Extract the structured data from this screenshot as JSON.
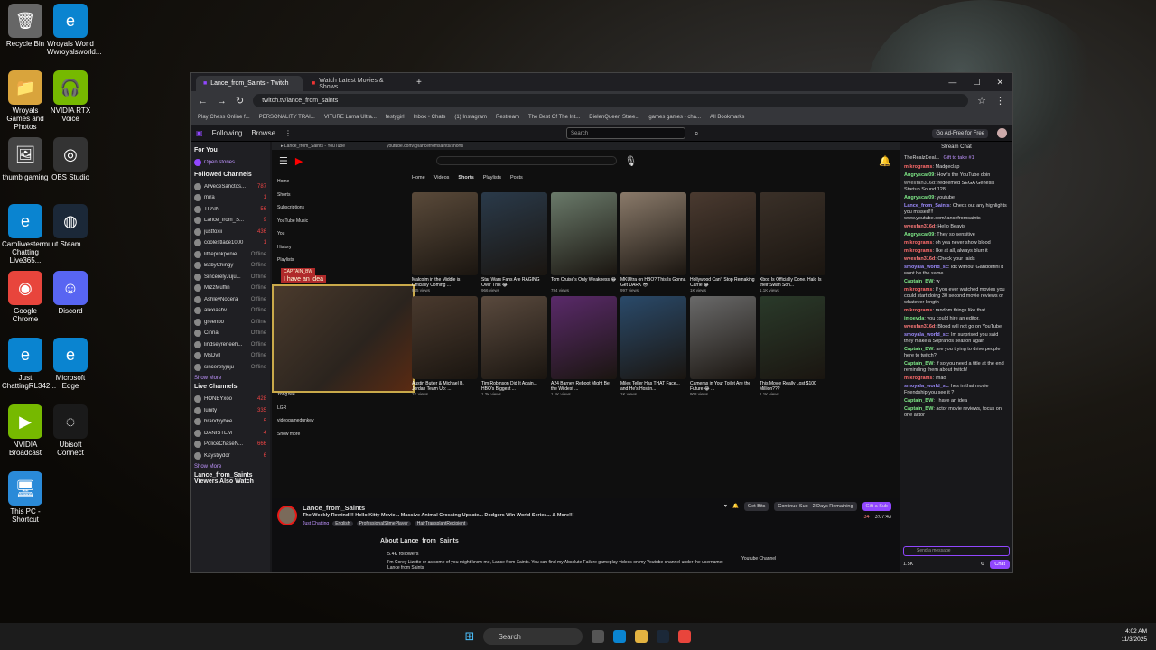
{
  "desktop": {
    "icons": [
      {
        "label": "Recycle Bin",
        "glyph": "🗑",
        "color": "#666"
      },
      {
        "label": "Wroyals Games and Photos",
        "glyph": "📁",
        "color": "#d9a43c"
      },
      {
        "label": "thumb gaming",
        "glyph": "🖼",
        "color": "#444"
      },
      {
        "label": "Caroliwestermuut Chatting Live365...",
        "glyph": "e",
        "color": "#0a84d0"
      },
      {
        "label": "Google Chrome",
        "glyph": "◉",
        "color": "#e8453c"
      },
      {
        "label": "Just ChattingRL342...",
        "glyph": "e",
        "color": "#0a84d0"
      },
      {
        "label": "NVIDIA Broadcast",
        "glyph": "▶",
        "color": "#76b900"
      },
      {
        "label": "This PC - Shortcut",
        "glyph": "🖥",
        "color": "#2a8ad8"
      },
      {
        "label": "Wroyals World Wwroyalsworld...",
        "glyph": "e",
        "color": "#0a84d0"
      },
      {
        "label": "NVIDIA RTX Voice",
        "glyph": "🎧",
        "color": "#76b900"
      },
      {
        "label": "OBS Studio",
        "glyph": "◎",
        "color": "#333"
      },
      {
        "label": "Steam",
        "glyph": "◍",
        "color": "#1b2838"
      },
      {
        "label": "Discord",
        "glyph": "☺",
        "color": "#5865f2"
      },
      {
        "label": "Microsoft Edge",
        "glyph": "e",
        "color": "#0a84d0"
      },
      {
        "label": "Ubisoft Connect",
        "glyph": "◌",
        "color": "#1a1a1a"
      }
    ]
  },
  "browser": {
    "tabs": [
      {
        "label": "Lance_from_Saints - Twitch"
      },
      {
        "label": "Watch Latest Movies & Shows"
      }
    ],
    "url": "twitch.tv/lance_from_saints",
    "bookmarks": [
      "Play Chess Online f...",
      "PERSONALITY TRAI...",
      "VITURE Luma Ultra...",
      "festygirl",
      "Inbox • Chats",
      "(1) Instagram",
      "Restream",
      "The Best Of The Int...",
      "DielenQueen Stree...",
      "games games - cha...",
      "All Bookmarks"
    ]
  },
  "twitch": {
    "nav": {
      "following": "Following",
      "browse": "Browse",
      "search_placeholder": "Search",
      "ad_free": "Go Ad-Free for Free"
    },
    "sidebar": {
      "for_you": "For You",
      "open_stories": "Open stories",
      "followed_header": "Followed Channels",
      "channels": [
        {
          "name": "AlweceSanctos...",
          "sub": "Animals, Aqua...",
          "count": "787"
        },
        {
          "name": "mira",
          "sub": "Just Chatting",
          "count": "1"
        },
        {
          "name": "TPAIN",
          "sub": "IRL There Yet?",
          "count": "56"
        },
        {
          "name": "Lance_from_S...",
          "sub": "Just Chatting",
          "count": "9"
        },
        {
          "name": "justfoxii",
          "sub": "Counter-Strike",
          "count": "436"
        },
        {
          "name": "coolestlace1000",
          "sub": "Warframe",
          "count": "1"
        },
        {
          "name": "littlepinkpenie",
          "sub": "",
          "count": "Offline"
        },
        {
          "name": "BabyChingy",
          "sub": "",
          "count": "Offline"
        },
        {
          "name": "SincerelyJuju...",
          "sub": "",
          "count": "Offline"
        },
        {
          "name": "MizzMuffin",
          "sub": "",
          "count": "Offline"
        },
        {
          "name": "AshleyNocera",
          "sub": "",
          "count": "Offline"
        },
        {
          "name": "alexiashv",
          "sub": "",
          "count": "Offline"
        },
        {
          "name": "greenbo",
          "sub": "",
          "count": "Offline"
        },
        {
          "name": "Cinna",
          "sub": "",
          "count": "Offline"
        },
        {
          "name": "lindseyreneeh...",
          "sub": "",
          "count": "Offline"
        },
        {
          "name": "MsDvil",
          "sub": "",
          "count": "Offline"
        },
        {
          "name": "sincerelyjuju",
          "sub": "",
          "count": "Offline"
        }
      ],
      "show_more": "Show More",
      "show_less": "Show Less",
      "live_header": "Live Channels",
      "live": [
        {
          "name": "HONEYxoo",
          "sub": "Escape from T...",
          "count": "428"
        },
        {
          "name": "lunity",
          "sub": "Pokémon Lege...",
          "count": "335"
        },
        {
          "name": "brandyybee",
          "sub": "Just Chatting",
          "count": "5"
        },
        {
          "name": "DANISTEM",
          "sub": "Just Chatting",
          "count": "4"
        },
        {
          "name": "PoliceChaseN...",
          "sub": "Just Chatting",
          "count": "666"
        },
        {
          "name": "Kaystrydor",
          "sub": "Just Chatting",
          "count": "6"
        }
      ],
      "footer": "Lance_from_Saints Viewers Also Watch"
    },
    "streamer": {
      "name": "Lance_from_Saints",
      "title": "The Weekly Rewind!!! Hello Kitty Movie... Massive Animal Crossing Update... Dodgers Win World Series... & More!!!",
      "category": "Just Chatting",
      "tags": [
        "English",
        "ProfessionalSlimePlayer",
        "HairTransplantRecipient"
      ],
      "viewers": "34",
      "uptime": "3:07:43",
      "get_bits": "Get Bits",
      "continue_sub": "Continue Sub - 2 Days Remaining",
      "gift_sub": "Gift a Sub",
      "about_title": "About Lance_from_Saints",
      "followers": "5.4K followers",
      "about_text": "I'm Corey Lizotte or as some of you might know me, Lance from Saints. You can find my Absolute Failure gameplay videos on my Youtube channel under the username: Lance from Saints",
      "youtube_link": "Youtube Channel"
    },
    "chat": {
      "header": "Stream Chat",
      "pinned": "TheRealzDeal...",
      "gift": "Gift to take #1",
      "messages": [
        {
          "user": "mikrograms",
          "text": "Madgeclap",
          "color": "#ff6b6b"
        },
        {
          "user": "Angryscar09",
          "text": "How's the YouTube doin",
          "color": "#7ee787"
        },
        {
          "user": "wvesfan316d",
          "text": "redeemed SEGA Genesis Startup Sound 128",
          "color": "#999"
        },
        {
          "user": "Angryscar09",
          "text": "youtube",
          "color": "#7ee787"
        },
        {
          "user": "Lance_from_Saints",
          "text": "Check out any highlights you missed!!! www.youtube.com/lancefromsaints",
          "color": "#9e8cff"
        },
        {
          "user": "wvesfan316d",
          "text": "Hello Beavis",
          "color": "#ff7a7a"
        },
        {
          "user": "Angryscar09",
          "text": "They so sensitive",
          "color": "#7ee787"
        },
        {
          "user": "mikrograms",
          "text": "oh yea never show blood",
          "color": "#ff6b6b"
        },
        {
          "user": "mikrograms",
          "text": "like at all, always blurr it",
          "color": "#ff6b6b"
        },
        {
          "user": "wvesfan316d",
          "text": "Check your raids",
          "color": "#ff7a7a"
        },
        {
          "user": "smoyala_world_sc",
          "text": "idk without Gandolffini it wont be the same",
          "color": "#9e8cff"
        },
        {
          "user": "Captain_BW",
          "text": "w",
          "color": "#7ee787"
        },
        {
          "user": "mikrograms",
          "text": "If you ever watched movies you could start doing 30 second movie reviews or whatever length",
          "color": "#ff6b6b"
        },
        {
          "user": "mikrograms",
          "text": "random things like that",
          "color": "#ff6b6b"
        },
        {
          "user": "imoevda",
          "text": "you could hire an editor.",
          "color": "#7ee787"
        },
        {
          "user": "wvesfan316d",
          "text": "Blood will not go on YouTube",
          "color": "#ff7a7a"
        },
        {
          "user": "smoyala_world_sc",
          "text": "Im surprised you said they make a Sopranos season again",
          "color": "#9e8cff"
        },
        {
          "user": "Captain_BW",
          "text": "are you trying to drive people here to twitch?",
          "color": "#7ee787"
        },
        {
          "user": "Captain_BW",
          "text": "If so you need a title at the end reminding them about twitch!",
          "color": "#7ee787"
        },
        {
          "user": "mikrograms",
          "text": "lmao",
          "color": "#ff6b6b"
        },
        {
          "user": "smoyala_world_sc",
          "text": "hes in that movie Friendship you see it ?",
          "color": "#9e8cff"
        },
        {
          "user": "Captain_BW",
          "text": "I have an idea",
          "color": "#7ee787"
        },
        {
          "user": "Captain_BW",
          "text": "actor movie reviews, focus on one actor",
          "color": "#7ee787"
        }
      ],
      "input_placeholder": "Send a message",
      "points": "1.5K",
      "chat_button": "Chat"
    }
  },
  "youtube": {
    "url": "youtube.com/@lancefromsaints/shorts",
    "tabs": [
      "Home",
      "Videos",
      "Shorts",
      "Playlists",
      "Posts"
    ],
    "nav": [
      "Home",
      "Shorts",
      "Subscriptions",
      "YouTube Music",
      "You",
      "History",
      "Playlists",
      "Your videos",
      "YongYee",
      "LGR",
      "videogamedunkey",
      "Show more"
    ],
    "overlay_label": "I have an idea",
    "overlay_user": "CAPTAIN_BW",
    "shorts": [
      {
        "title": "Malcolm in the Middle is Officially Coming ...",
        "views": "945 views",
        "c": "#5a4a3a"
      },
      {
        "title": "Star Wars Fans Are RAGING Over This 😂",
        "views": "966 views",
        "c": "#2a3a4a"
      },
      {
        "title": "Tom Cruise's Only Weakness 😂",
        "views": "784 views",
        "c": "#6a7a6a"
      },
      {
        "title": "MKUltra on HBO? This Is Gonna Get DARK 😳",
        "views": "997 views",
        "c": "#8a7a6a"
      },
      {
        "title": "Hollywood Can't Stop Remaking Carrie 😂",
        "views": "1K views",
        "c": "#4a3a30"
      },
      {
        "title": "Xbox Is Officially Done. Halo Is their Swan Son...",
        "views": "1.1K views",
        "c": "#3a3028"
      },
      {
        "title": "Austin Butler & Michael B. Jordan Team Up: ...",
        "views": "1K views",
        "c": "#4a3a2e"
      },
      {
        "title": "Tim Robinson Did It Again... HBO's Biggest ...",
        "views": "1.2K views",
        "c": "#5a4a3e"
      },
      {
        "title": "A24 Barney Reboot Might Be the Wildest ...",
        "views": "1.1K views",
        "c": "#5a2a6a"
      },
      {
        "title": "Miles Teller Has THAT Face... and He's Hostin...",
        "views": "1K views",
        "c": "#2a4a6a"
      },
      {
        "title": "Cameras in Your Toilet Are the Future 😂 ...",
        "views": "908 views",
        "c": "#6a6a6a"
      },
      {
        "title": "This Movie Really Lost $100 Million???",
        "views": "1.1K views",
        "c": "#2a3a2a"
      }
    ]
  },
  "taskbar": {
    "search": "Search",
    "time": "4:02 AM",
    "date": "11/3/2025"
  }
}
